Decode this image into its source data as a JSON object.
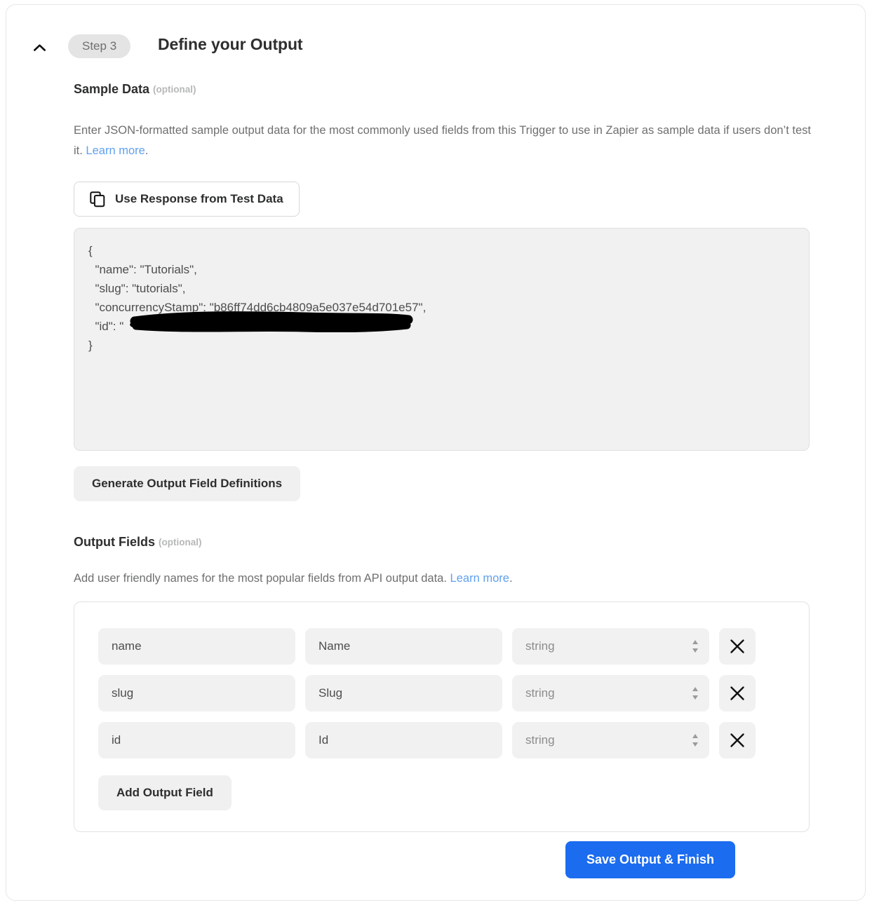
{
  "header": {
    "collapse_icon": "chevron-up-icon",
    "step_badge": "Step 3",
    "title": "Define your Output"
  },
  "sample_data": {
    "label": "Sample Data",
    "optional": "(optional)",
    "description_part1": "Enter JSON-formatted sample output data for the most commonly used fields from this Trigger to use in Zapier as sample data if users don’t test it. ",
    "learn_more": "Learn more",
    "description_end": ".",
    "use_response_button": "Use Response from Test Data",
    "use_response_icon": "copy-icon",
    "json_value": "{\n  \"name\": \"Tutorials\",\n  \"slug\": \"tutorials\",\n  \"concurrencyStamp\": \"b86ff74dd6cb4809a5e037e54d701e57\",\n  \"id\": \"\n}",
    "redaction_note": "redacted-id-value",
    "generate_button": "Generate Output Field Definitions"
  },
  "output_fields": {
    "label": "Output Fields",
    "optional": "(optional)",
    "description_part1": "Add user friendly names for the most popular fields from API output data. ",
    "learn_more": "Learn more",
    "description_end": ".",
    "rows": [
      {
        "key": "name",
        "label": "Name",
        "type": "string",
        "remove_icon": "close-icon"
      },
      {
        "key": "slug",
        "label": "Slug",
        "type": "string",
        "remove_icon": "close-icon"
      },
      {
        "key": "id",
        "label": "Id",
        "type": "string",
        "remove_icon": "close-icon"
      }
    ],
    "add_button": "Add Output Field"
  },
  "footer": {
    "save_button": "Save Output & Finish"
  },
  "colors": {
    "primary": "#1b6cef",
    "link": "#60a0ee",
    "badge_bg": "#e4e4e4",
    "field_bg": "#f1f1f1",
    "text": "#2d2e2e",
    "muted": "#6e6f70"
  }
}
